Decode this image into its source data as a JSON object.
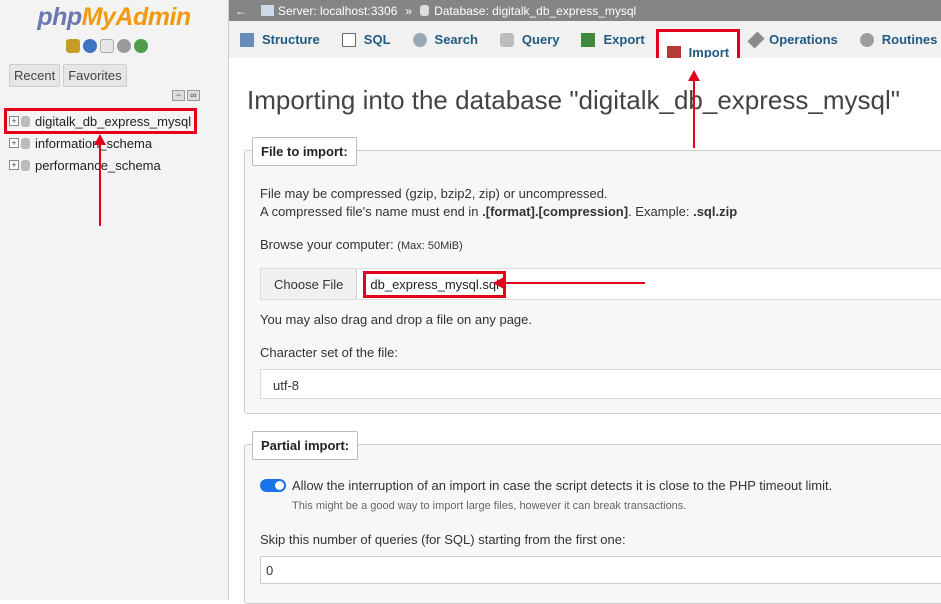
{
  "logo": {
    "part1": "php",
    "part2": "MyAdmin"
  },
  "nav": {
    "tabs": [
      "Recent",
      "Favorites"
    ],
    "collapse_all": "−",
    "link": "∞",
    "expand_symbol": "+",
    "databases": [
      "digitalk_db_express_mysql",
      "information_schema",
      "performance_schema"
    ]
  },
  "breadcrumb": {
    "back_arrow": "←",
    "server": "Server: localhost:3306",
    "separator": "»",
    "database": "Database: digitalk_db_express_mysql"
  },
  "tabs": [
    "Structure",
    "SQL",
    "Search",
    "Query",
    "Export",
    "Import",
    "Operations",
    "Routines"
  ],
  "active_tab": "Import",
  "title": "Importing into the database \"digitalk_db_express_mysql\"",
  "file_section": {
    "legend": "File to import:",
    "compress_note": "File may be compressed (gzip, bzip2, zip) or uncompressed.",
    "name_note_pre": "A compressed file's name must end in ",
    "name_note_format": ".[format].[compression]",
    "name_note_mid": ". Example: ",
    "name_note_example": ".sql.zip",
    "browse_label": "Browse your computer:",
    "max_size": "(Max: 50MiB)",
    "choose_button": "Choose File",
    "file_name": "db_express_mysql.sql",
    "drag_note": "You may also drag and drop a file on any page.",
    "charset_label": "Character set of the file:",
    "charset_value": "utf-8"
  },
  "partial_section": {
    "legend": "Partial import:",
    "allow_interrupt": "Allow the interruption of an import in case the script detects it is close to the PHP timeout limit.",
    "allow_interrupt_on": true,
    "interrupt_hint": "This might be a good way to import large files, however it can break transactions.",
    "skip_label": "Skip this number of queries (for SQL) starting from the first one:",
    "skip_value": "0"
  },
  "colors": {
    "annotation": "#e3001b",
    "link": "#235a81",
    "toggle": "#1a73e8"
  }
}
